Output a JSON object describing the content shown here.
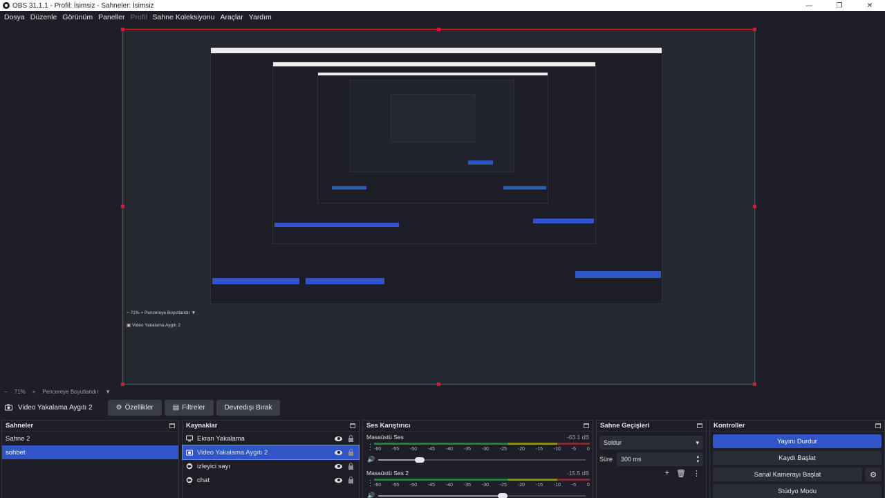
{
  "window": {
    "title": "OBS 31.1.1 - Profil: İsimsiz - Sahneler: İsimsiz",
    "controls": [
      "—",
      "❐",
      "✕"
    ]
  },
  "menu": {
    "items": [
      {
        "label": "Dosya",
        "enabled": true
      },
      {
        "label": "Düzenle",
        "enabled": true
      },
      {
        "label": "Görünüm",
        "enabled": true
      },
      {
        "label": "Paneller",
        "enabled": true
      },
      {
        "label": "Profil",
        "enabled": false
      },
      {
        "label": "Sahne Koleksiyonu",
        "enabled": true
      },
      {
        "label": "Araçlar",
        "enabled": true
      },
      {
        "label": "Yardım",
        "enabled": true
      }
    ]
  },
  "zoom": {
    "minus": "−",
    "value": "71%",
    "plus": "+",
    "mode": "Pencereye Boyutlandır",
    "caret": "▼"
  },
  "source_toolbar": {
    "selected_source": "Video Yakalama Aygıtı 2",
    "properties": "Özellikler",
    "filters": "Filtreler",
    "deactivate": "Devredışı Bırak"
  },
  "scenes": {
    "title": "Sahneler",
    "items": [
      "Sahne 2",
      "sohbet"
    ],
    "active_index": 1
  },
  "sources": {
    "title": "Kaynaklar",
    "items": [
      {
        "label": "Ekran Yakalama",
        "icon": "monitor-icon"
      },
      {
        "label": "Video Yakalama Aygıtı 2",
        "icon": "camera-icon"
      },
      {
        "label": "izleyici sayı",
        "icon": "globe-icon"
      },
      {
        "label": "chat",
        "icon": "globe-icon"
      }
    ],
    "active_index": 1
  },
  "mixer": {
    "title": "Ses Karıştırıcı",
    "ticks": [
      "-60",
      "-55",
      "-50",
      "-45",
      "-40",
      "-35",
      "-30",
      "-25",
      "-20",
      "-15",
      "-10",
      "-5",
      "0"
    ],
    "channels": [
      {
        "name": "Masaüstü Ses",
        "db": "-63.1 dB",
        "volume": 0.2
      },
      {
        "name": "Masaüstü Ses 2",
        "db": "-15.5 dB",
        "volume": 0.6
      }
    ]
  },
  "transitions": {
    "title": "Sahne Geçişleri",
    "selected": "Soldur",
    "duration_label": "Süre",
    "duration_value": "300 ms"
  },
  "controls": {
    "title": "Kontroller",
    "stop_stream": "Yayını Durdur",
    "start_record": "Kaydı Başlat",
    "virtual_camera": "Sanal Kamerayı Başlat",
    "studio_mode": "Stüdyo Modu"
  },
  "colors": {
    "accent": "#2f55c7",
    "selection": "#d21a35",
    "background": "#1e1f26"
  }
}
